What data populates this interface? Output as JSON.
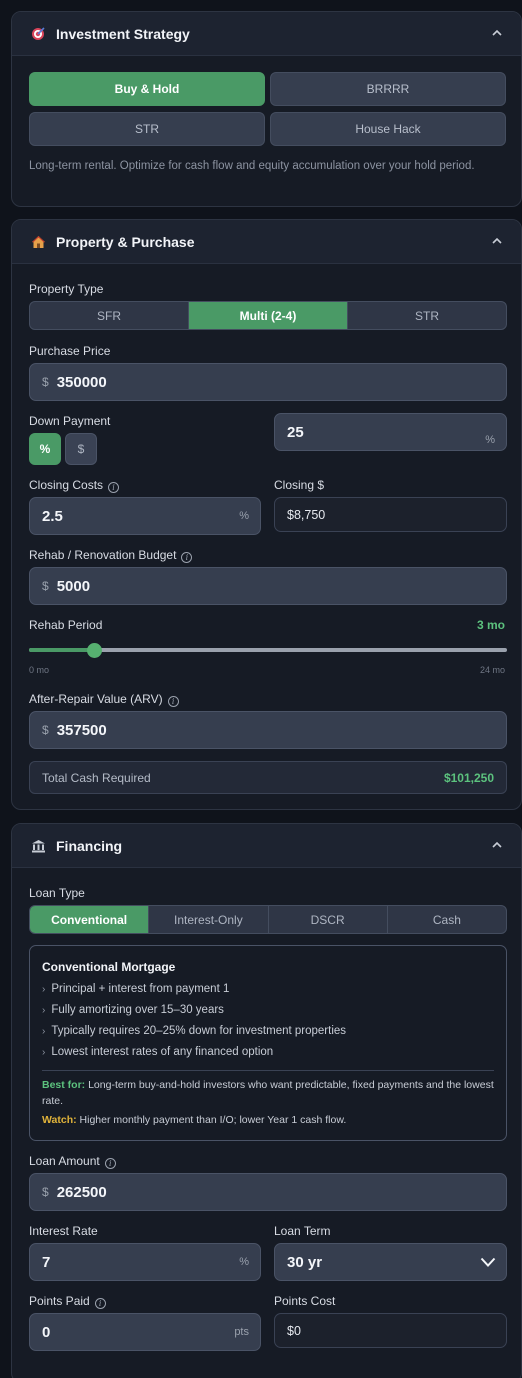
{
  "strategy": {
    "title": "Investment Strategy",
    "options": [
      "Buy & Hold",
      "BRRRR",
      "STR",
      "House Hack"
    ],
    "selected": "Buy & Hold",
    "description": "Long-term rental. Optimize for cash flow and equity accumulation over your hold period."
  },
  "property": {
    "title": "Property & Purchase",
    "property_type_label": "Property Type",
    "property_types": [
      "SFR",
      "Multi (2-4)",
      "STR"
    ],
    "property_type_selected": "Multi (2-4)",
    "purchase_price_label": "Purchase Price",
    "purchase_price": "350000",
    "down_payment_label": "Down Payment",
    "down_payment_modes": [
      "%",
      "$"
    ],
    "down_payment_mode_selected": "%",
    "down_payment_value": "25",
    "closing_costs_label": "Closing Costs",
    "closing_costs_pct": "2.5",
    "closing_dollar_label": "Closing $",
    "closing_dollar_value": "$8,750",
    "rehab_label": "Rehab / Renovation Budget",
    "rehab_value": "5000",
    "rehab_period_label": "Rehab Period",
    "rehab_period_value": "3 mo",
    "rehab_period_months": 3,
    "rehab_period_min_label": "0 mo",
    "rehab_period_max_label": "24 mo",
    "rehab_period_max": 24,
    "arv_label": "After-Repair Value (ARV)",
    "arv_value": "357500",
    "total_cash_label": "Total Cash Required",
    "total_cash_value": "$101,250"
  },
  "financing": {
    "title": "Financing",
    "loan_type_label": "Loan Type",
    "loan_types": [
      "Conventional",
      "Interest-Only",
      "DSCR",
      "Cash"
    ],
    "loan_type_selected": "Conventional",
    "info_title": "Conventional Mortgage",
    "info_points": [
      "Principal + interest from payment 1",
      "Fully amortizing over 15–30 years",
      "Typically requires 20–25% down for investment properties",
      "Lowest interest rates of any financed option"
    ],
    "best_for_label": "Best for:",
    "best_for_text": "Long-term buy-and-hold investors who want predictable, fixed payments and the lowest rate.",
    "watch_label": "Watch:",
    "watch_text": "Higher monthly payment than I/O; lower Year 1 cash flow.",
    "loan_amount_label": "Loan Amount",
    "loan_amount": "262500",
    "interest_rate_label": "Interest Rate",
    "interest_rate": "7",
    "loan_term_label": "Loan Term",
    "loan_term": "30 yr",
    "points_paid_label": "Points Paid",
    "points_paid": "0",
    "points_cost_label": "Points Cost",
    "points_cost": "$0"
  },
  "units": {
    "dollar": "$",
    "percent": "%",
    "pts": "pts",
    "info": "i"
  },
  "colors": {
    "accent": "#4a9a66",
    "accent_text": "#5cc27e",
    "watch": "#e0b33a"
  }
}
